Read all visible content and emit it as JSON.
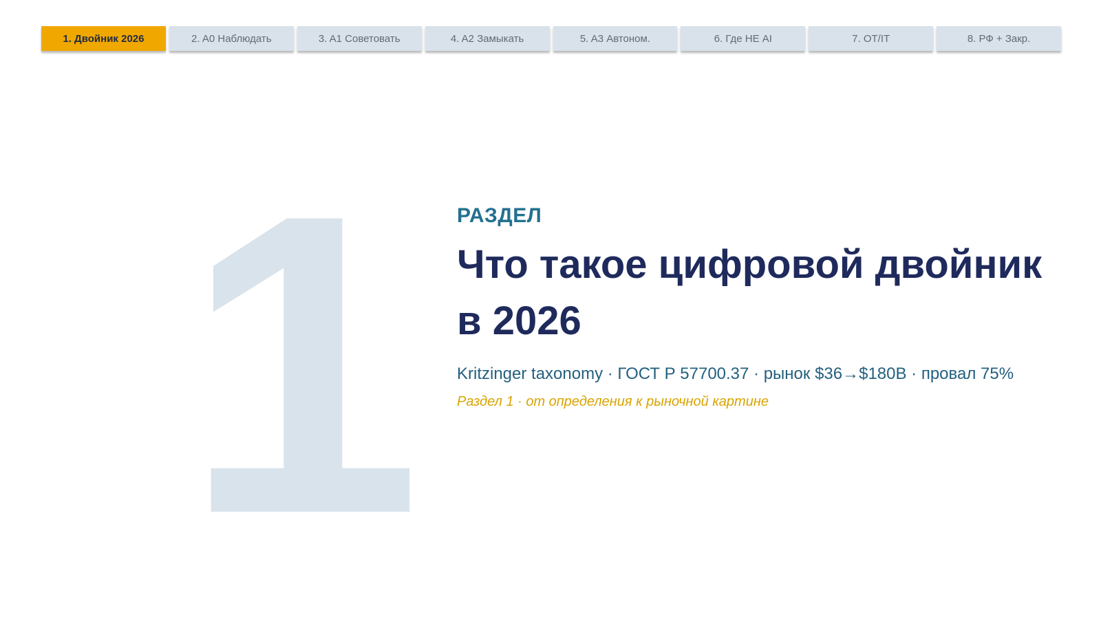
{
  "nav": {
    "tabs": [
      {
        "label": "1. Двойник 2026",
        "active": true
      },
      {
        "label": "2. A0 Наблюдать",
        "active": false
      },
      {
        "label": "3. A1 Советовать",
        "active": false
      },
      {
        "label": "4. A2 Замыкать",
        "active": false
      },
      {
        "label": "5. A3 Автоном.",
        "active": false
      },
      {
        "label": "6. Где НЕ AI",
        "active": false
      },
      {
        "label": "7. OT/IT",
        "active": false
      },
      {
        "label": "8. РФ + Закр.",
        "active": false
      }
    ],
    "active_color": "#f0a800",
    "inactive_color": "#d9e2ea"
  },
  "section": {
    "number": "1",
    "label": "РАЗДЕЛ",
    "title_line1": "Что такое цифровой двойник",
    "title_line2": "в 2026",
    "subtitle": "Kritzinger taxonomy · ГОСТ Р 57700.37 · рынок $36→$180B · провал 75%",
    "caption": "Раздел 1 · от определения к рыночной картине"
  },
  "colors": {
    "title": "#1f2a5c",
    "label": "#23708f",
    "caption": "#d9a400",
    "big_number": "#d9e3eb"
  }
}
